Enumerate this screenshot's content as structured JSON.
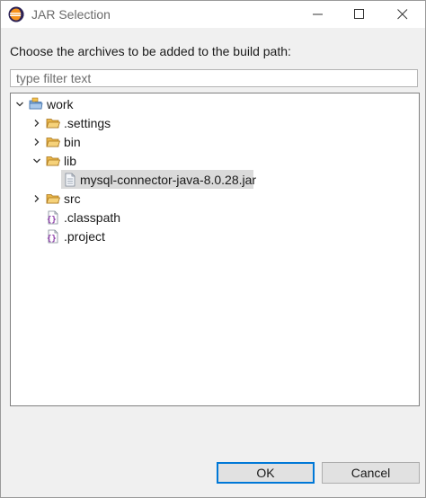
{
  "window": {
    "title": "JAR Selection"
  },
  "prompt": "Choose the archives to be added to the build path:",
  "filter": {
    "placeholder": "type filter text",
    "value": ""
  },
  "tree": {
    "root": "work",
    "items": [
      {
        "label": ".settings",
        "type": "folder",
        "expanded": false
      },
      {
        "label": "bin",
        "type": "folder",
        "expanded": false
      },
      {
        "label": "lib",
        "type": "folder",
        "expanded": true
      },
      {
        "label": "mysql-connector-java-8.0.28.jar",
        "type": "jar",
        "selected": true
      },
      {
        "label": "src",
        "type": "folder",
        "expanded": false
      },
      {
        "label": ".classpath",
        "type": "xml-file"
      },
      {
        "label": ".project",
        "type": "xml-file"
      }
    ]
  },
  "buttons": {
    "ok": "OK",
    "cancel": "Cancel"
  },
  "colors": {
    "folder": "#e8b64a",
    "accent": "#0078d7",
    "selection": "#dadada"
  }
}
